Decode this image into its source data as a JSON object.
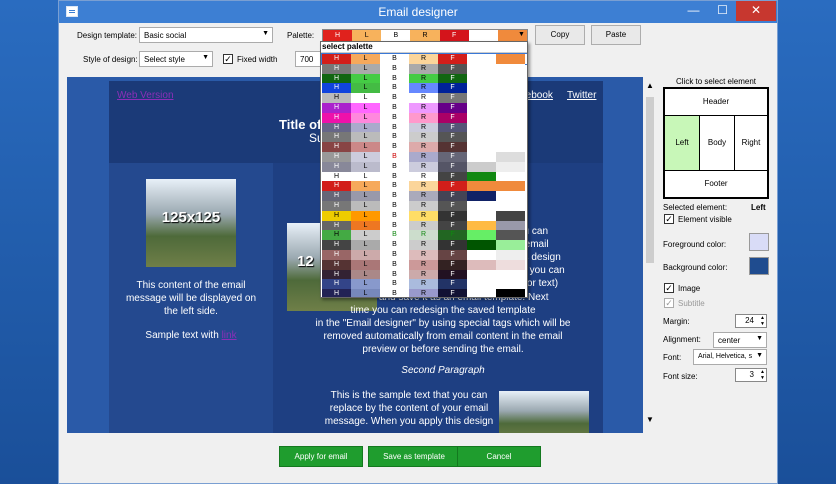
{
  "window": {
    "title": "Email designer"
  },
  "toolbar": {
    "design_template_label": "Design template:",
    "design_template_value": "Basic social",
    "palette_label": "Palette:",
    "copy_label": "Copy",
    "paste_label": "Paste",
    "style_label": "Style of design:",
    "style_value": "Select style",
    "fixed_width_label": "Fixed width",
    "fixed_width_checked": true,
    "width_value": "700"
  },
  "palette_selected": {
    "labels": [
      "H",
      "L",
      "B",
      "R",
      "F",
      ""
    ],
    "colors": [
      "#e0221d",
      "#f7b25c",
      "#ffffff",
      "#f7b25c",
      "#d4141b",
      "#ffffff",
      "#f08a3c"
    ]
  },
  "palette_dropdown": {
    "header": "select palette",
    "rows": [
      {
        "c": [
          "#d21e1a",
          "#f6a95b",
          "#ffffff",
          "#fbd59a",
          "#d21e1a",
          "#ffffff",
          "#f08a3c"
        ],
        "t": [
          "#fff",
          "#000",
          "#000",
          "#000",
          "#fff",
          "#000",
          "#000"
        ]
      },
      {
        "c": [
          "#777777",
          "#aaaaaa",
          "#ffffff",
          "#aaaaaa",
          "#555555",
          "#ffffff",
          "#ffffff"
        ],
        "t": [
          "#fff",
          "#000",
          "#000",
          "#000",
          "#fff",
          "#000",
          "#000"
        ]
      },
      {
        "c": [
          "#116611",
          "#44cc44",
          "#ffffff",
          "#44cc44",
          "#116611",
          "#ffffff",
          "#ffffff"
        ],
        "t": [
          "#fff",
          "#000",
          "#000",
          "#000",
          "#fff",
          "#000",
          "#000"
        ]
      },
      {
        "c": [
          "#1144dd",
          "#44bb44",
          "#ffffff",
          "#6688ff",
          "#002299",
          "#ffffff",
          "#ffffff"
        ],
        "t": [
          "#fff",
          "#000",
          "#000",
          "#000",
          "#fff",
          "#000",
          "#000"
        ]
      },
      {
        "c": [
          "#bbbbbb",
          "#ffffff",
          "#ffffff",
          "#ffffff",
          "#777777",
          "#ffffff",
          "#ffffff"
        ],
        "t": [
          "#000",
          "#000",
          "#000",
          "#000",
          "#fff",
          "#000",
          "#000"
        ]
      },
      {
        "c": [
          "#aa22cc",
          "#ff66ff",
          "#ffffff",
          "#ee99ff",
          "#660088",
          "#ffffff",
          "#ffffff"
        ],
        "t": [
          "#fff",
          "#000",
          "#000",
          "#000",
          "#fff",
          "#000",
          "#000"
        ]
      },
      {
        "c": [
          "#ee11aa",
          "#ff88dd",
          "#ffffff",
          "#ff99cc",
          "#aa0066",
          "#ffffff",
          "#ffffff"
        ],
        "t": [
          "#fff",
          "#000",
          "#000",
          "#000",
          "#fff",
          "#000",
          "#000"
        ]
      },
      {
        "c": [
          "#666688",
          "#aaaacc",
          "#ffffff",
          "#ccccdd",
          "#555577",
          "#ffffff",
          "#ffffff"
        ],
        "t": [
          "#fff",
          "#000",
          "#000",
          "#000",
          "#fff",
          "#000",
          "#000"
        ]
      },
      {
        "c": [
          "#777777",
          "#bbbbbb",
          "#ffffff",
          "#cccccc",
          "#555555",
          "#ffffff",
          "#ffffff"
        ],
        "t": [
          "#fff",
          "#000",
          "#000",
          "#000",
          "#fff",
          "#000",
          "#000"
        ]
      },
      {
        "c": [
          "#884444",
          "#cc8888",
          "#ffffff",
          "#ddaaaa",
          "#553333",
          "#ffffff",
          "#ffffff"
        ],
        "t": [
          "#fff",
          "#000",
          "#000",
          "#000",
          "#fff",
          "#000",
          "#000"
        ]
      },
      {
        "c": [
          "#999999",
          "#ccccdd",
          "#ffffff",
          "#aaaacc",
          "#666677",
          "#ffffff",
          "#dddddd"
        ],
        "t": [
          "#fff",
          "#000",
          "#cc0000",
          "#000",
          "#fff",
          "#000",
          "#000"
        ]
      },
      {
        "c": [
          "#888899",
          "#bbbbcc",
          "#ffffff",
          "#ccccdd",
          "#555566",
          "#cccccc",
          "#eeeeee"
        ],
        "t": [
          "#fff",
          "#000",
          "#000",
          "#000",
          "#fff",
          "#000",
          "#000"
        ]
      },
      {
        "c": [
          "#ffffff",
          "#ffffff",
          "#ffffff",
          "#ffffff",
          "#444444",
          "#118811",
          "#ffffff"
        ],
        "t": [
          "#000",
          "#000",
          "#000",
          "#000",
          "#fff",
          "#000",
          "#000"
        ]
      },
      {
        "c": [
          "#d21e1a",
          "#f6a95b",
          "#ffffff",
          "#fbd59a",
          "#d21e1a",
          "#f08a3c",
          "#f08a3c"
        ],
        "t": [
          "#fff",
          "#000",
          "#000",
          "#000",
          "#fff",
          "#000",
          "#000"
        ]
      },
      {
        "c": [
          "#666677",
          "#9999aa",
          "#ffffff",
          "#aaaabb",
          "#444455",
          "#112266",
          "#ffffff"
        ],
        "t": [
          "#fff",
          "#000",
          "#000",
          "#000",
          "#fff",
          "#000",
          "#000"
        ]
      },
      {
        "c": [
          "#777777",
          "#bbbbbb",
          "#ffffff",
          "#cccccc",
          "#555555",
          "#ffffff",
          "#ffffff"
        ],
        "t": [
          "#fff",
          "#000",
          "#000",
          "#000",
          "#fff",
          "#000",
          "#000"
        ]
      },
      {
        "c": [
          "#eecc00",
          "#ff9900",
          "#ffffff",
          "#ffdd66",
          "#333333",
          "#ffffff",
          "#444444"
        ],
        "t": [
          "#000",
          "#000",
          "#000",
          "#000",
          "#fff",
          "#000",
          "#000"
        ]
      },
      {
        "c": [
          "#666666",
          "#ee7722",
          "#ffffff",
          "#cccccc",
          "#444444",
          "#ffbb44",
          "#9999aa"
        ],
        "t": [
          "#fff",
          "#000",
          "#000",
          "#000",
          "#fff",
          "#000",
          "#000"
        ]
      },
      {
        "c": [
          "#44aa44",
          "#cccccc",
          "#ffffff",
          "#ccddcc",
          "#226622",
          "#66ee66",
          "#555555"
        ],
        "t": [
          "#000",
          "#000",
          "#118811",
          "#118811",
          "#118811",
          "#000",
          "#000"
        ]
      },
      {
        "c": [
          "#444444",
          "#aaaaaa",
          "#ffffff",
          "#cccccc",
          "#333333",
          "#005500",
          "#99ee99"
        ],
        "t": [
          "#fff",
          "#000",
          "#000",
          "#000",
          "#fff",
          "#000",
          "#000"
        ]
      },
      {
        "c": [
          "#996666",
          "#ccaaaa",
          "#ffffff",
          "#ddbbbb",
          "#664444",
          "#ffffff",
          "#eeeeee"
        ],
        "t": [
          "#fff",
          "#000",
          "#000",
          "#000",
          "#fff",
          "#000",
          "#000"
        ]
      },
      {
        "c": [
          "#553333",
          "#aa7777",
          "#ffffff",
          "#cc9999",
          "#332222",
          "#ddbbbb",
          "#eedddd"
        ],
        "t": [
          "#fff",
          "#000",
          "#000",
          "#000",
          "#fff",
          "#000",
          "#000"
        ]
      },
      {
        "c": [
          "#332233",
          "#aa8888",
          "#ffffff",
          "#ccaaaa",
          "#221122",
          "#ffffff",
          "#ffffff"
        ],
        "t": [
          "#fff",
          "#000",
          "#000",
          "#000",
          "#fff",
          "#000",
          "#000"
        ]
      },
      {
        "c": [
          "#334488",
          "#8899cc",
          "#ffffff",
          "#aabbdd",
          "#223366",
          "#ffffff",
          "#ffffff"
        ],
        "t": [
          "#fff",
          "#000",
          "#000",
          "#000",
          "#fff",
          "#000",
          "#000"
        ]
      },
      {
        "c": [
          "#222255",
          "#7788bb",
          "#ffffff",
          "#9999cc",
          "#111133",
          "#ffffff",
          "#000000"
        ],
        "t": [
          "#fff",
          "#000",
          "#000",
          "#000",
          "#fff",
          "#000",
          "#000"
        ]
      }
    ],
    "row_labels": [
      "H",
      "L",
      "B",
      "R",
      "F"
    ]
  },
  "email": {
    "web_version": "Web Version",
    "facebook": "Facebook",
    "twitter": "Twitter",
    "title": "Title of",
    "subtitle": "Su",
    "image_placeholder": "125x125",
    "left_text": "This content of the email message will be displayed on the left side.",
    "sample_text": "Sample text with",
    "link_text": "link",
    "right_text_lines": [
      "you can",
      "ur email",
      "this design",
      "ge, you can",
      "go or text)"
    ],
    "right_para_line1": "and save it as an email template. Next",
    "right_para_line2": "time you can redesign the saved template",
    "right_para_line3": "in the \"Email designer\" by using special tags which will be",
    "right_para_line4": "removed automatically from email content in the email",
    "right_para_line5": "preview or before sending the email.",
    "second_paragraph": "Second Paragraph",
    "bottom_text_line1": "This is the sample text that you can",
    "bottom_text_line2": "replace by the content of your email",
    "bottom_text_line3": "message. When you apply this design"
  },
  "right_panel": {
    "click_to_select": "Click to select element",
    "header": "Header",
    "left": "Left",
    "body": "Body",
    "right": "Right",
    "footer": "Footer",
    "selected_element_label": "Selected element:",
    "selected_element_value": "Left",
    "element_visible_label": "Element visible",
    "foreground_label": "Foreground color:",
    "background_label": "Background color:",
    "foreground_color": "#d9dcf7",
    "background_color": "#1f4c8f",
    "image_label": "Image",
    "subtitle_label": "Subtitle",
    "margin_label": "Margin:",
    "margin_value": "24",
    "alignment_label": "Alignment:",
    "alignment_value": "center",
    "font_label": "Font:",
    "font_value": "Arial, Helvetica, s",
    "font_size_label": "Font size:",
    "font_size_value": "3"
  },
  "buttons": {
    "apply": "Apply for email",
    "save_template": "Save as template",
    "cancel": "Cancel"
  }
}
